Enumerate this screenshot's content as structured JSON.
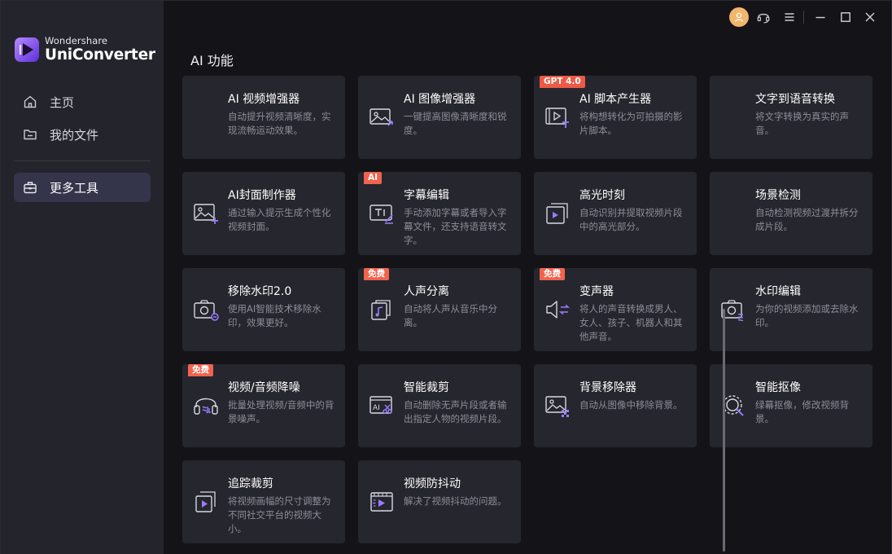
{
  "brand": {
    "company": "Wondershare",
    "product": "UniConverter"
  },
  "sidebar": {
    "items": [
      {
        "label": "主页",
        "icon": "home-icon"
      },
      {
        "label": "我的文件",
        "icon": "folder-icon"
      },
      {
        "label": "更多工具",
        "icon": "toolbox-icon",
        "active": true
      }
    ]
  },
  "titlebar": {
    "buttons": [
      "avatar-icon",
      "headset-icon",
      "menu-icon",
      "minimize-icon",
      "maximize-icon",
      "close-icon"
    ]
  },
  "main": {
    "section_title": "AI 功能",
    "cards": [
      {
        "title": "AI 视频增强器",
        "desc": "自动提升视频清晰度，实现流畅运动效果。",
        "badge": "",
        "icon": "video-enhance-icon"
      },
      {
        "title": "AI 图像增强器",
        "desc": "一键提高图像清晰度和锐度。",
        "badge": "",
        "icon": "image-enhance-icon"
      },
      {
        "title": "AI 脚本产生器",
        "desc": "将构想转化为可拍摄的影片脚本。",
        "badge": "GPT 4.0",
        "icon": "script-icon"
      },
      {
        "title": "文字到语音转换",
        "desc": "将文字转换为真实的声音。",
        "badge": "",
        "icon": "text-to-speech-icon"
      },
      {
        "title": "AI封面制作器",
        "desc": "通过输入提示生成个性化视频封面。",
        "badge": "",
        "icon": "cover-maker-icon"
      },
      {
        "title": "字幕编辑",
        "desc": "手动添加字幕或者导入字幕文件，还支持语音转文字。",
        "badge": "AI",
        "icon": "subtitle-icon"
      },
      {
        "title": "高光时刻",
        "desc": "自动识别并提取视频片段中的高光部分。",
        "badge": "",
        "icon": "highlight-icon"
      },
      {
        "title": "场景检测",
        "desc": "自动检测视频过渡并拆分成片段。",
        "badge": "",
        "icon": "scene-detect-icon"
      },
      {
        "title": "移除水印2.0",
        "desc": "使用AI智能技术移除水印，效果更好。",
        "badge": "",
        "icon": "watermark-remove-icon"
      },
      {
        "title": "人声分离",
        "desc": "自动将人声从音乐中分离。",
        "badge": "免费",
        "icon": "vocal-remover-icon"
      },
      {
        "title": "变声器",
        "desc": "将人的声音转换成男人、女人、孩子、机器人和其他声音。",
        "badge": "免费",
        "icon": "voice-changer-icon"
      },
      {
        "title": "水印编辑",
        "desc": "为你的视频添加或去除水印。",
        "badge": "",
        "icon": "watermark-edit-icon"
      },
      {
        "title": "视频/音频降噪",
        "desc": "批量处理视频/音频中的背景噪声。",
        "badge": "免费",
        "icon": "noise-reduce-icon"
      },
      {
        "title": "智能裁剪",
        "desc": "自动删除无声片段或者输出指定人物的视频片段。",
        "badge": "",
        "icon": "smart-trim-icon"
      },
      {
        "title": "背景移除器",
        "desc": "自动从图像中移除背景。",
        "badge": "",
        "icon": "bg-remover-icon"
      },
      {
        "title": "智能抠像",
        "desc": "绿幕抠像，修改视频背景。",
        "badge": "",
        "icon": "smart-cutout-icon"
      },
      {
        "title": "追踪裁剪",
        "desc": "将视频画幅的尺寸调整为不同社交平台的视频大小。",
        "badge": "",
        "icon": "auto-reframe-icon"
      },
      {
        "title": "视频防抖动",
        "desc": "解决了视频抖动的问题。",
        "badge": "",
        "icon": "stabilize-icon"
      }
    ]
  },
  "colors": {
    "accent": "#8a6cf0",
    "badge": "#f0634e",
    "card": "#26262e",
    "sidebar": "#24242c",
    "avatar": "#f2b56b"
  }
}
